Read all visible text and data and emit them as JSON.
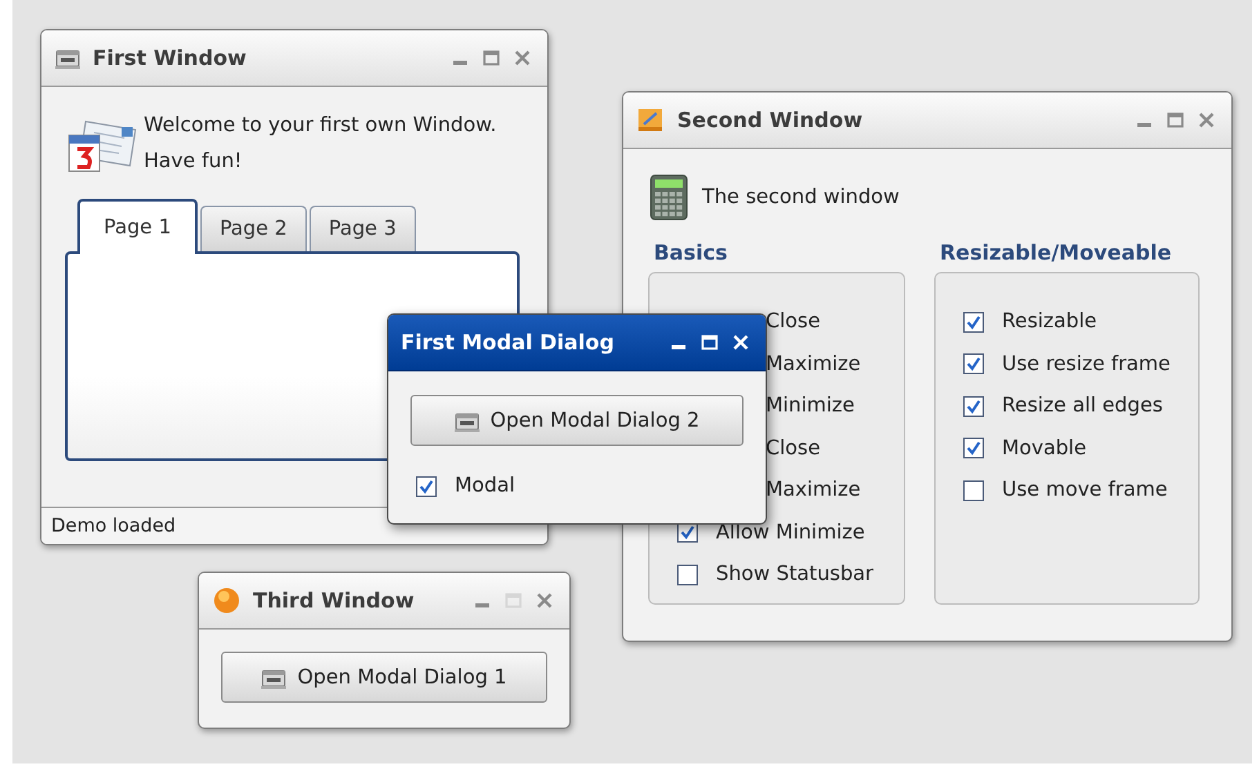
{
  "second_window": {
    "title": "Second Window",
    "maximize_disabled": false,
    "message": "The second window",
    "groups": [
      {
        "title": "Basics",
        "options": [
          {
            "kind": "covered",
            "label": "Close"
          },
          {
            "kind": "covered",
            "label": "Maximize"
          },
          {
            "kind": "covered",
            "label": "Minimize"
          },
          {
            "kind": "covered",
            "label": "Close"
          },
          {
            "kind": "covered",
            "label": "Maximize"
          },
          {
            "kind": "checkbox",
            "label": "Allow Minimize",
            "checked": true
          },
          {
            "kind": "checkbox",
            "label": "Show Statusbar",
            "checked": false
          }
        ]
      },
      {
        "title": "Resizable/Moveable",
        "options": [
          {
            "kind": "checkbox",
            "label": "Resizable",
            "checked": true
          },
          {
            "kind": "checkbox",
            "label": "Use resize frame",
            "checked": true
          },
          {
            "kind": "checkbox",
            "label": "Resize all edges",
            "checked": true
          },
          {
            "kind": "checkbox",
            "label": "Movable",
            "checked": true
          },
          {
            "kind": "checkbox",
            "label": "Use move frame",
            "checked": false
          }
        ]
      }
    ]
  },
  "first_window": {
    "title": "First Window",
    "maximize_disabled": false,
    "message": "Welcome to your first own Window. Have fun!",
    "tabs": [
      {
        "label": "Page 1",
        "selected": true
      },
      {
        "label": "Page 2",
        "selected": false
      },
      {
        "label": "Page 3",
        "selected": false
      }
    ],
    "status": "Demo loaded"
  },
  "modal_dialog": {
    "title": "First Modal Dialog",
    "maximize_disabled": false,
    "button": "Open Modal Dialog 2",
    "option": {
      "label": "Modal",
      "checked": true
    }
  },
  "third_window": {
    "title": "Third Window",
    "maximize_disabled": true,
    "button": "Open Modal Dialog 1"
  }
}
